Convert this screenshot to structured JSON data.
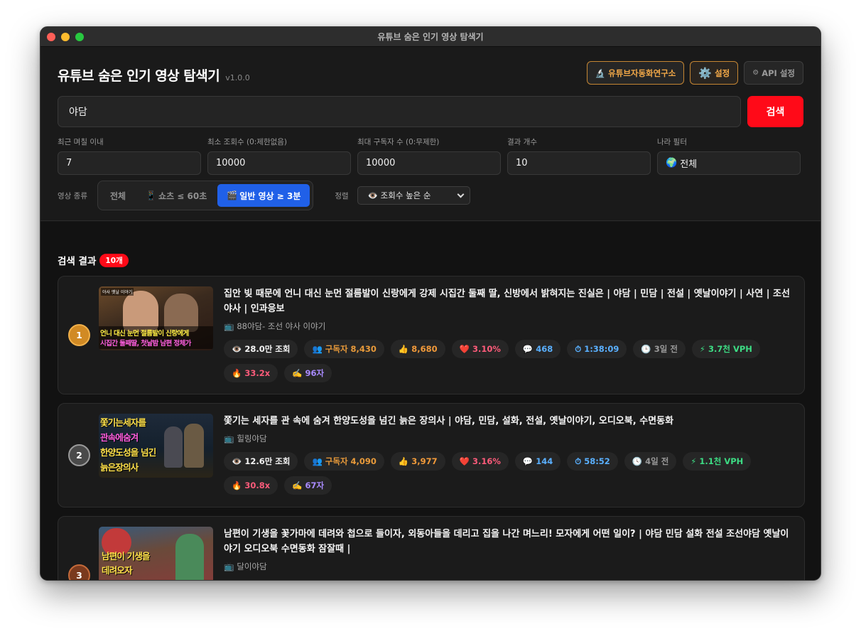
{
  "window": {
    "title": "유튜브 숨은 인기 영상 탐색기"
  },
  "header": {
    "app_title": "유튜브 숨은 인기 영상 탐색기",
    "version": "v1.0.0",
    "buttons": {
      "lab": "유튜브자동화연구소",
      "settings": "설정",
      "api": "API 설정"
    }
  },
  "search": {
    "value": "야담",
    "button_label": "검색"
  },
  "filters": [
    {
      "label": "최근 며칠 이내",
      "value": "7"
    },
    {
      "label": "최소 조회수 (0:제한없음)",
      "value": "10000"
    },
    {
      "label": "최대 구독자 수 (0:무제한)",
      "value": "10000"
    },
    {
      "label": "결과 개수",
      "value": "10"
    },
    {
      "label": "나라 필터",
      "value": "전체"
    }
  ],
  "video_type": {
    "label": "영상 종류",
    "options": [
      "전체",
      "쇼츠 ≤ 60초",
      "일반 영상 ≥ 3분"
    ],
    "selected": "일반 영상 ≥ 3분"
  },
  "sort": {
    "label": "정렬",
    "value": "조회수 높은 순"
  },
  "results": {
    "heading": "검색 결과",
    "count": "10개",
    "items": [
      {
        "rank": "1",
        "title": "집안 빚 때문에 언니 대신 눈먼 절름발이 신랑에게 강제 시집간 둘째 딸, 신방에서 밝혀지는 진실은 | 야담 | 민담 | 전설 | 옛날이야기 | 사연 | 조선야사 | 인과응보",
        "channel": "88야담- 조선 야사 이야기",
        "thumb_caption_1": "언니 대신 눈먼 절름발이 신랑에게",
        "thumb_caption_2": "시집간 둘째딸, 첫날밤 남편 정체가",
        "thumb_tag": "야사 옛날 이야기",
        "views": "28.0만 조회",
        "subscribers": "구독자 8,430",
        "likes": "8,680",
        "like_ratio": "3.10%",
        "comments": "468",
        "duration": "1:38:09",
        "age": "3일 전",
        "vph": "3.7천 VPH",
        "multiplier": "33.2x",
        "chars": "96자"
      },
      {
        "rank": "2",
        "title": "쫓기는 세자를 관 속에 숨겨 한양도성을 넘긴 늙은 장의사 | 야담, 민담, 설화, 전설, 옛날이야기, 오디오북, 수면동화",
        "channel": "힐링야담",
        "thumb_lines": [
          "쫓기는세자를",
          "관속에숨겨",
          "한양도성을 넘긴",
          "늙은장의사"
        ],
        "views": "12.6만 조회",
        "subscribers": "구독자 4,090",
        "likes": "3,977",
        "like_ratio": "3.16%",
        "comments": "144",
        "duration": "58:52",
        "age": "4일 전",
        "vph": "1.1천 VPH",
        "multiplier": "30.8x",
        "chars": "67자"
      },
      {
        "rank": "3",
        "title": "남편이 기생을 꽃가마에 데려와 첩으로 들이자, 외동아들을 데리고 집을 나간 며느리! 모자에게 어떤 일이? | 야담 민담 설화 전설 조선야담 옛날이야기 오디오북 수면동화 잠잘때 |",
        "channel": "달이야담",
        "thumb_lines": [
          "남편이 기생을",
          "데려오자"
        ]
      }
    ]
  },
  "colors": {
    "accent_red": "#ff0a18",
    "accent_blue": "#2060e8",
    "accent_orange": "#f3a948"
  },
  "icons": [
    "microscope-icon",
    "gear-icon",
    "globe-icon",
    "phone-icon",
    "clapperboard-icon",
    "eye-icon",
    "people-icon",
    "thumbs-up-icon",
    "heart-icon",
    "speech-bubble-icon",
    "stopwatch-icon",
    "clock-icon",
    "lightning-icon",
    "fire-icon",
    "writing-hand-icon",
    "tv-icon",
    "chevron-down-icon"
  ]
}
